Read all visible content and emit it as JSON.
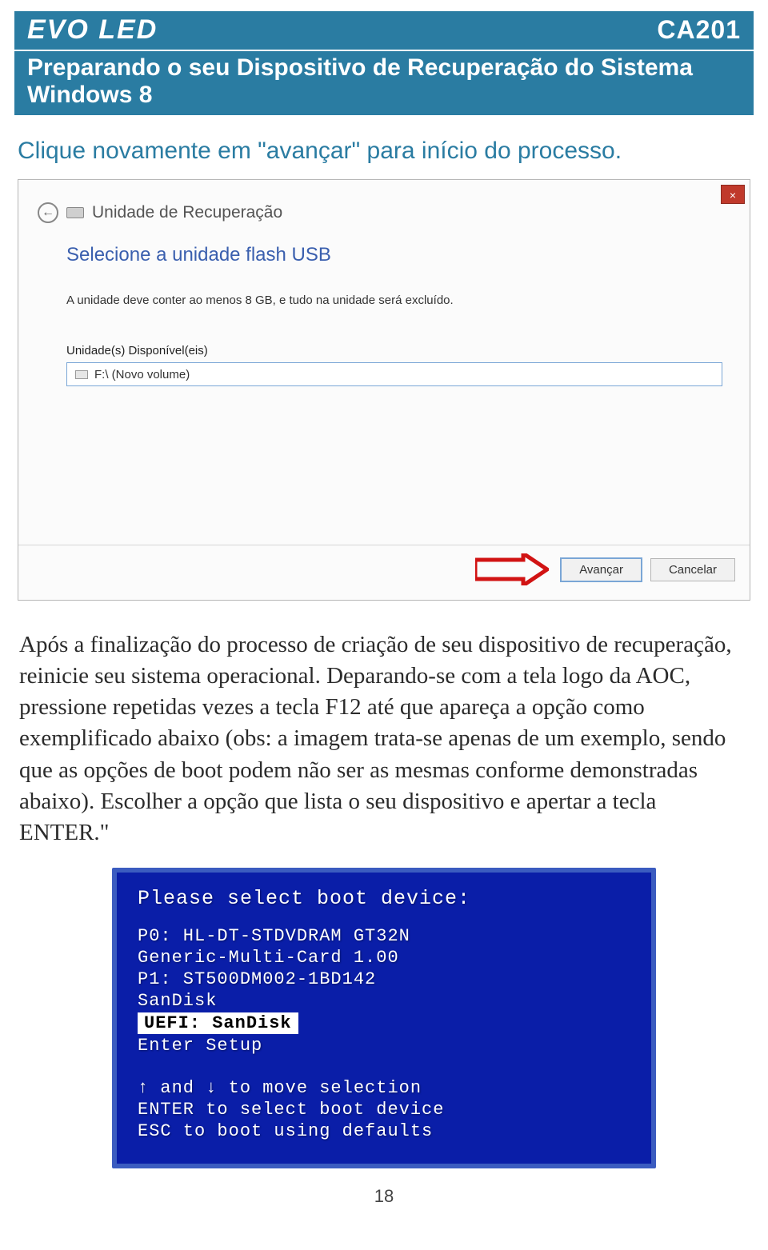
{
  "header": {
    "brand": "EVO LED",
    "model": "CA201",
    "subtitle": "Preparando o seu Dispositivo de Recuperação do Sistema Windows 8"
  },
  "lead": "Clique novamente em \"avançar\" para início do processo.",
  "recovery_window": {
    "close_label": "×",
    "back_icon_name": "back-arrow-icon",
    "title": "Unidade de Recuperação",
    "heading": "Selecione a unidade flash USB",
    "note": "A unidade deve conter ao menos 8 GB, e tudo na unidade será excluído.",
    "available_label": "Unidade(s) Disponível(eis)",
    "selected_drive": "F:\\ (Novo volume)",
    "advance_label": "Avançar",
    "cancel_label": "Cancelar"
  },
  "paragraph": "Após a finalização do processo de criação de seu dispositivo de recuperação, reinicie seu sistema operacional. Deparando-se com a tela logo da AOC, pressione repetidas vezes a tecla F12 até que apareça a opção como exemplificado abaixo (obs: a imagem trata-se apenas de um exemplo, sendo que as opções de boot podem não ser as mesmas conforme demonstradas abaixo). Escolher a opção que lista o seu dispositivo e apertar a tecla ENTER.\"",
  "bios": {
    "title": "Please select boot device:",
    "lines": [
      "P0: HL-DT-STDVDRAM GT32N",
      "Generic-Multi-Card 1.00",
      "P1: ST500DM002-1BD142",
      "SanDisk"
    ],
    "highlight": "UEFI: SanDisk",
    "after_highlight": "Enter Setup",
    "hint1": "↑ and ↓ to move selection",
    "hint2": "ENTER to select boot device",
    "hint3": "ESC to boot using defaults"
  },
  "page_number": "18"
}
